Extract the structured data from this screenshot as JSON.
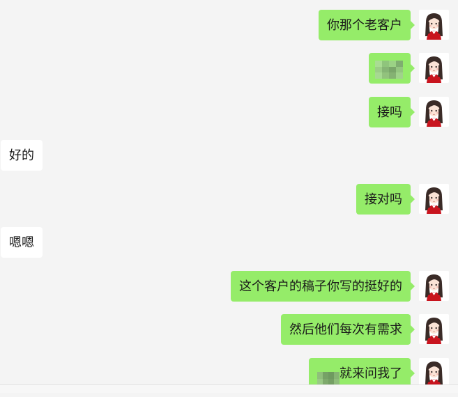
{
  "conversation": {
    "messages": [
      {
        "side": "out",
        "text": "你那个老客户"
      },
      {
        "side": "out",
        "text": ""
      },
      {
        "side": "out",
        "text": "接吗"
      },
      {
        "side": "in",
        "text": "好的"
      },
      {
        "side": "out",
        "text": "接对吗"
      },
      {
        "side": "in",
        "text": "嗯嗯"
      },
      {
        "side": "out",
        "text": "这个客户的稿子你写的挺好的"
      },
      {
        "side": "out",
        "text": "然后他们每次有需求"
      },
      {
        "side": "out",
        "text": "就来问我了"
      }
    ]
  },
  "colors": {
    "background": "#f4f4f4",
    "outgoing_bubble": "#95ec69",
    "incoming_bubble": "#ffffff",
    "avatar_jacket": "#c8141e",
    "avatar_hair": "#3a2b27"
  },
  "icons": {
    "avatar": "cartoon-girl-avatar-icon",
    "blurred": "pixelated-redaction"
  }
}
